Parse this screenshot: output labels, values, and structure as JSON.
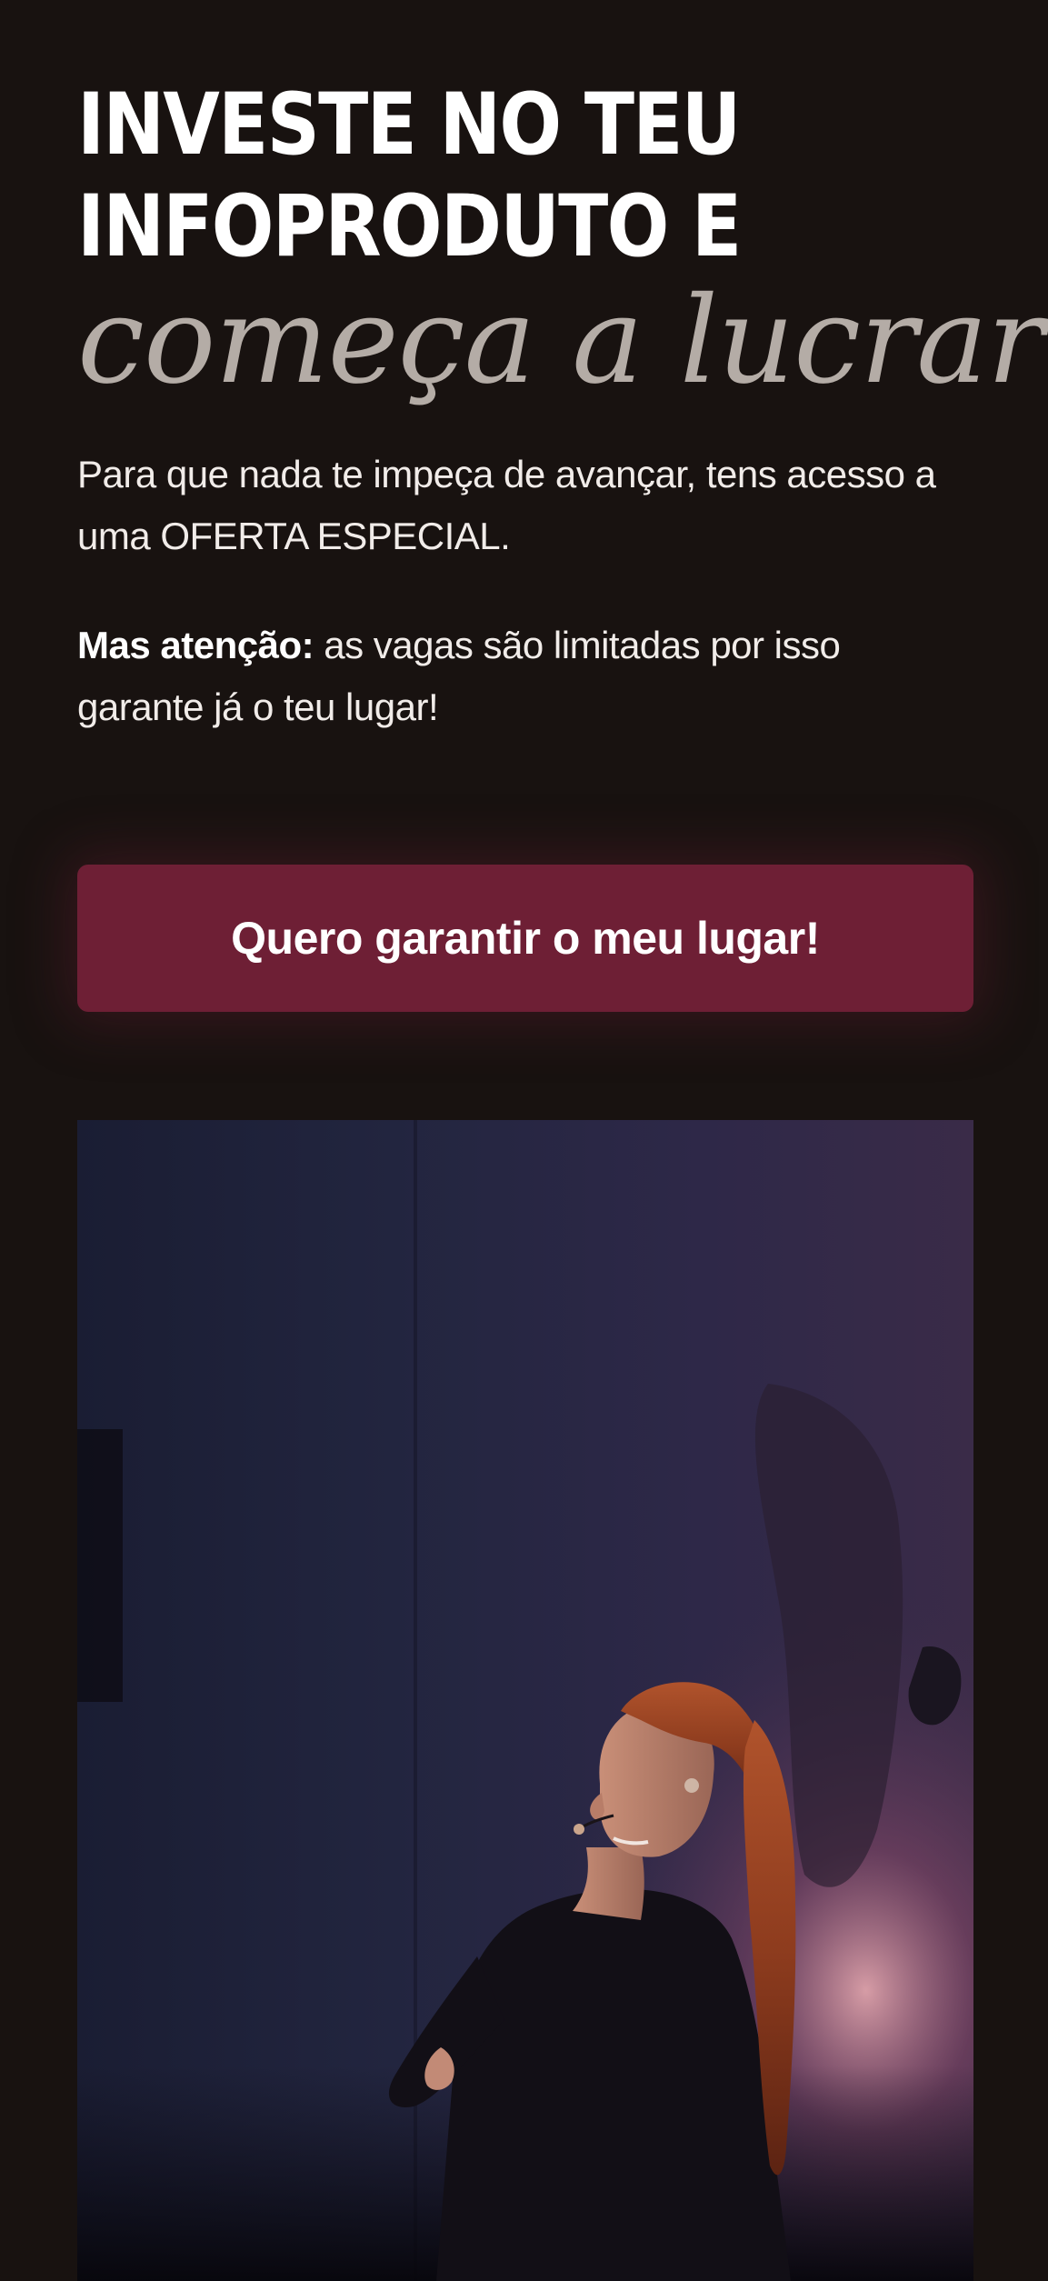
{
  "hero": {
    "headline_line1": "INVESTE NO TEU",
    "headline_line2": "INFOPRODUTO E",
    "headline_script": "começa a lucrar",
    "paragraph1": "Para que nada te impeça de avançar, tens acesso a uma OFERTA ESPECIAL.",
    "paragraph2_bold": "Mas atenção:",
    "paragraph2_rest": " as vagas são limitadas por isso garante já o teu lugar!",
    "cta_label": "Quero garantir o meu lugar!"
  },
  "colors": {
    "background": "#181210",
    "cta_background": "#6e1f35",
    "script_text": "#b4aca6",
    "text": "#f1ece9"
  }
}
